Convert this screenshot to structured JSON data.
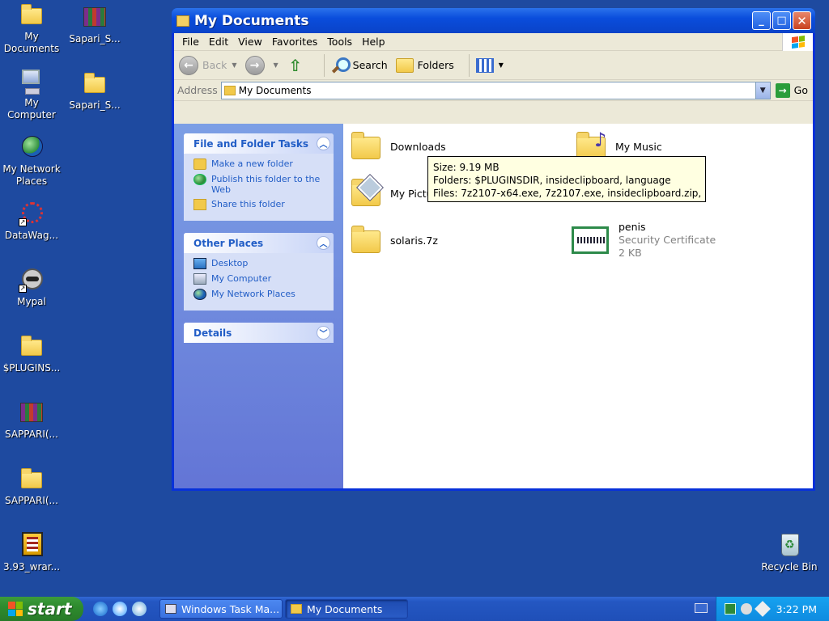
{
  "desktop": {
    "icons": [
      {
        "label": "My Documents"
      },
      {
        "label": "Sapari_S..."
      },
      {
        "label": "My Computer"
      },
      {
        "label": "Sapari_S..."
      },
      {
        "label": "My Network Places"
      },
      {
        "label": "DataWag..."
      },
      {
        "label": "Mypal"
      },
      {
        "label": "$PLUGINS..."
      },
      {
        "label": "SAPPARI(..."
      },
      {
        "label": "SAPPARI(..."
      },
      {
        "label": "3.93_wrar..."
      },
      {
        "label": "Recycle Bin"
      }
    ]
  },
  "window": {
    "title": "My Documents",
    "menu": [
      "File",
      "Edit",
      "View",
      "Favorites",
      "Tools",
      "Help"
    ],
    "toolbar": {
      "back": "Back",
      "search": "Search",
      "folders": "Folders"
    },
    "address": {
      "label": "Address",
      "value": "My Documents",
      "go": "Go"
    },
    "taskpane": {
      "file_tasks": {
        "title": "File and Folder Tasks",
        "items": [
          "Make a new folder",
          "Publish this folder to the Web",
          "Share this folder"
        ]
      },
      "other_places": {
        "title": "Other Places",
        "items": [
          "Desktop",
          "My Computer",
          "My Network Places"
        ]
      },
      "details": {
        "title": "Details"
      }
    },
    "items": [
      {
        "name": "Downloads"
      },
      {
        "name": "My Music"
      },
      {
        "name": "My Pictu"
      },
      {
        "name": "solaris.7z"
      },
      {
        "name": "penis",
        "type": "Security Certificate",
        "size": "2 KB"
      }
    ],
    "tooltip": {
      "line1": "Size: 9.19 MB",
      "line2": "Folders: $PLUGINSDIR, insideclipboard, language",
      "line3": "Files: 7z2107-x64.exe, 7z2107.exe, insideclipboard.zip, ..."
    }
  },
  "taskbar": {
    "start": "start",
    "buttons": [
      {
        "label": "Windows Task Ma..."
      },
      {
        "label": "My Documents"
      }
    ],
    "clock": "3:22 PM"
  },
  "colors": {
    "desktop_bg": "#1e4aa0",
    "title_bar": "#0a4ddc",
    "link_blue": "#215dc6",
    "start_green": "#2e8b2e",
    "tooltip_bg": "#ffffe1"
  }
}
